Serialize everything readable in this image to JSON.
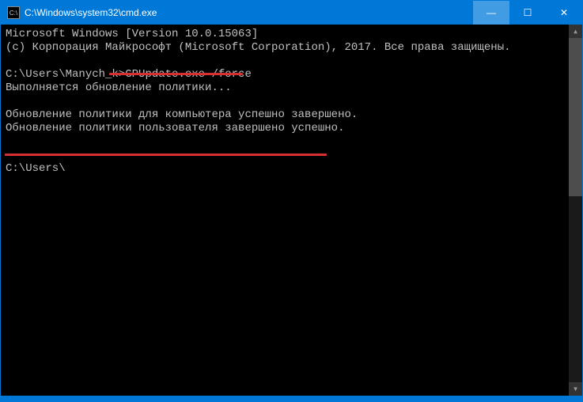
{
  "window": {
    "title": "C:\\Windows\\system32\\cmd.exe"
  },
  "terminal": {
    "line1": "Microsoft Windows [Version 10.0.15063]",
    "line2": "(с) Корпорация Майкрософт (Microsoft Corporation), 2017. Все права защищены.",
    "line3_prompt": "C:\\Users\\Manych_k>",
    "line3_cmd": "GPUpdate.exe /force",
    "line4": "Выполняется обновление политики...",
    "line5": "Обновление политики для компьютера успешно завершено.",
    "line6": "Обновление политики пользователя завершено успешно.",
    "line7_prompt": "C:\\Users\\"
  },
  "icons": {
    "cmd": "C:\\",
    "minimize": "—",
    "maximize": "☐",
    "close": "✕",
    "scroll_up": "▲",
    "scroll_down": "▼"
  }
}
